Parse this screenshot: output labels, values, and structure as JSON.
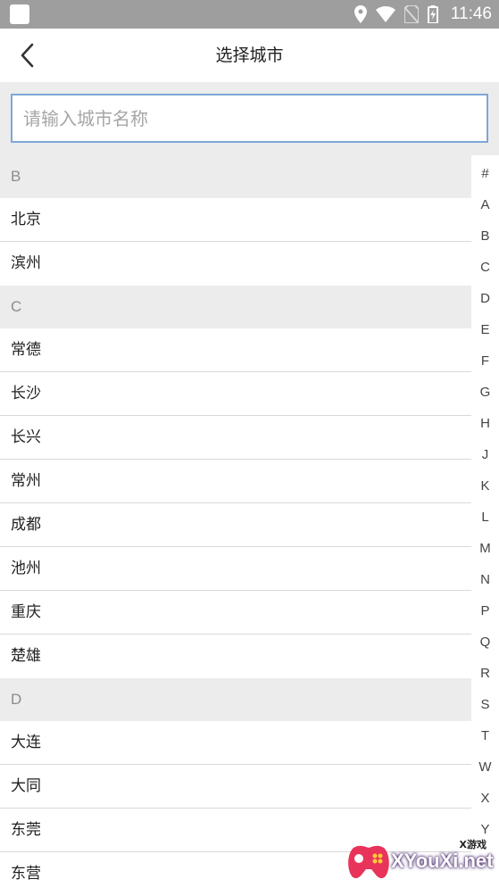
{
  "status_bar": {
    "time": "11:46",
    "icons": [
      "location-icon",
      "wifi-icon",
      "no-sim-icon",
      "battery-icon"
    ]
  },
  "header": {
    "title": "选择城市",
    "back_icon": "chevron-left-icon"
  },
  "search": {
    "placeholder": "请输入城市名称",
    "value": ""
  },
  "groups": [
    {
      "letter": "B",
      "cities": [
        "北京",
        "滨州"
      ]
    },
    {
      "letter": "C",
      "cities": [
        "常德",
        "长沙",
        "长兴",
        "常州",
        "成都",
        "池州",
        "重庆",
        "楚雄"
      ]
    },
    {
      "letter": "D",
      "cities": [
        "大连",
        "大同",
        "东莞",
        "东营"
      ]
    }
  ],
  "index_bar": [
    "#",
    "A",
    "B",
    "C",
    "D",
    "E",
    "F",
    "G",
    "H",
    "J",
    "K",
    "L",
    "M",
    "N",
    "P",
    "Q",
    "R",
    "S",
    "T",
    "W",
    "X",
    "Y"
  ],
  "watermark": {
    "small": "X游戏",
    "text": "XYouXi.net"
  },
  "colors": {
    "status_bar": "#9e9e9e",
    "group_header_bg": "#ececec",
    "search_border": "#7ea7d6",
    "index_text": "#444444"
  }
}
